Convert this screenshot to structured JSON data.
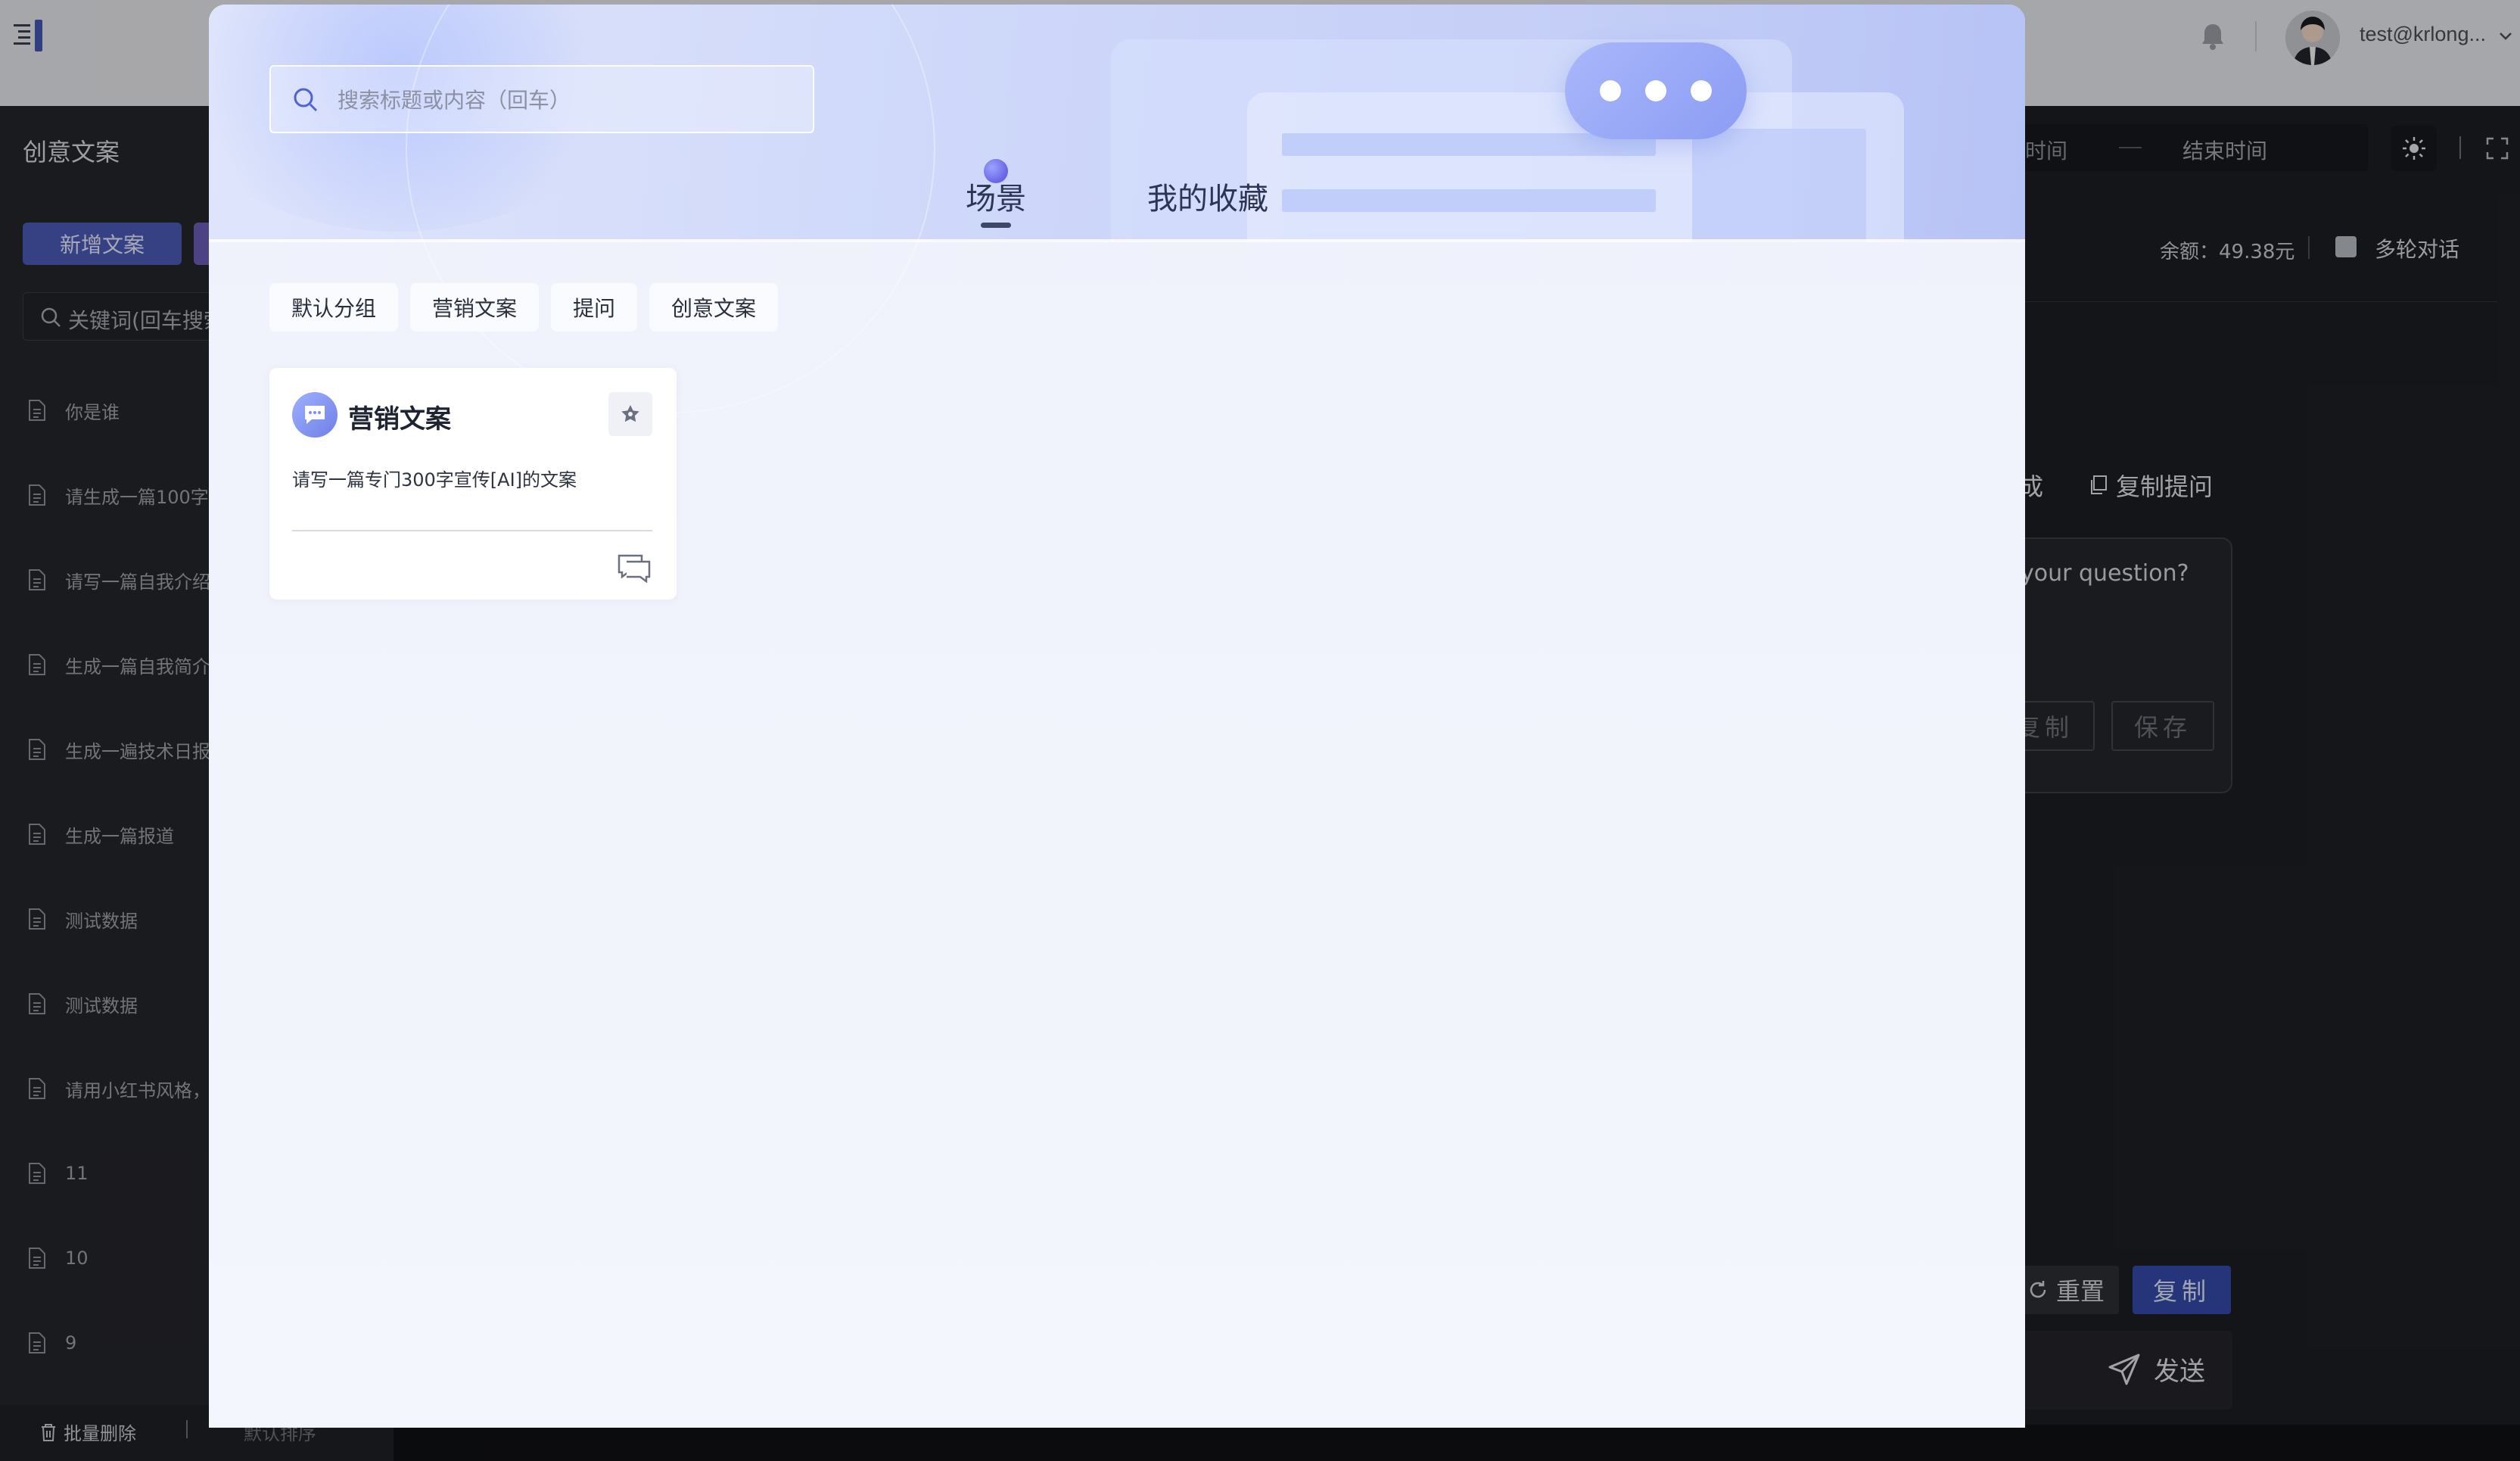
{
  "header": {
    "username": "test@krlong...",
    "icons": [
      "menu-toggle-icon",
      "bell-icon",
      "avatar",
      "chevron-down-icon"
    ]
  },
  "sidebar": {
    "title": "创意文案",
    "new_button": "新增文案",
    "search_placeholder": "关键词(回车搜索)",
    "items": [
      {
        "label": "你是谁"
      },
      {
        "label": "请生成一篇100字"
      },
      {
        "label": "请写一篇自我介绍"
      },
      {
        "label": "生成一篇自我简介"
      },
      {
        "label": "生成一遍技术日报"
      },
      {
        "label": "生成一篇报道"
      },
      {
        "label": "测试数据"
      },
      {
        "label": "测试数据"
      },
      {
        "label": "请用小红书风格，"
      },
      {
        "label": "11"
      },
      {
        "label": "10"
      },
      {
        "label": "9"
      }
    ],
    "footer": {
      "batch_delete": "批量删除",
      "sort": "默认排序"
    }
  },
  "main": {
    "start_time": "时间",
    "end_time": "结束时间",
    "balance": "余额：49.38元",
    "multi_turn": "多轮对话",
    "generate_suffix": "成",
    "copy_question": "复制提问",
    "answer_placeholder": "your question?",
    "answer_copy": "复制",
    "answer_save": "保存",
    "reset": "重置",
    "copy": "复制",
    "send": "发送"
  },
  "modal": {
    "search_placeholder": "搜索标题或内容（回车）",
    "tabs": [
      {
        "label": "场景",
        "active": true
      },
      {
        "label": "我的收藏",
        "active": false
      }
    ],
    "groups": [
      {
        "label": "默认分组"
      },
      {
        "label": "营销文案"
      },
      {
        "label": "提问"
      },
      {
        "label": "创意文案"
      }
    ],
    "cards": [
      {
        "title": "营销文案",
        "description": "请写一篇专门300字宣传[AI]的文案",
        "icon": "chat-bubble-icon",
        "favorite_icon": "star-icon",
        "use_icon": "chat-icon"
      }
    ]
  },
  "colors": {
    "accent": "#4b5bb8",
    "primary_button": "#3549a8",
    "modal_hero": "#c6d0f7",
    "bubble": "#8c9cf3"
  }
}
